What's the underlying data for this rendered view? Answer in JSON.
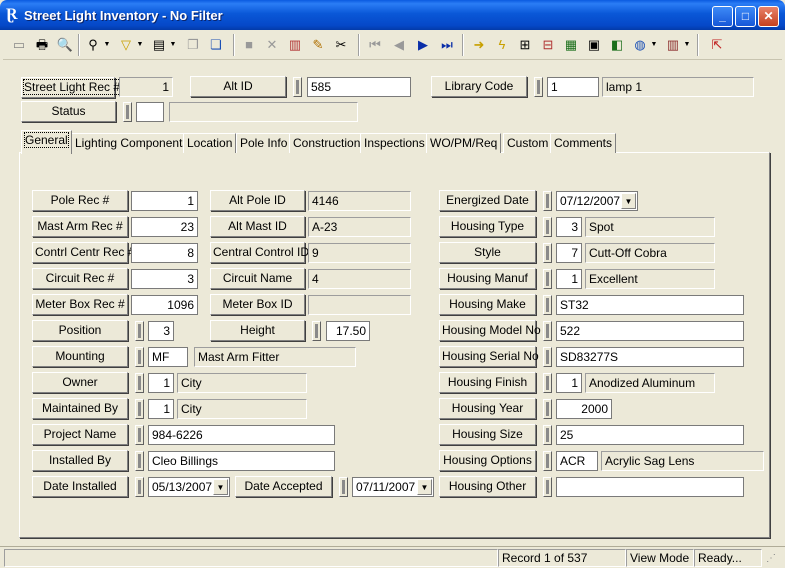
{
  "window": {
    "title": "Street Light Inventory - No Filter",
    "app_icon_glyph": "Ɽ"
  },
  "toolbar": {
    "icons": [
      "new-record-icon",
      "print-icon",
      "print-preview-icon",
      "binoculars-icon",
      "filter-icon",
      "form-icon",
      "copy-record-icon",
      "window-icon",
      "save-icon",
      "delete-icon",
      "books-icon",
      "pencil-icon",
      "scissors-icon",
      "first-record-icon",
      "previous-record-icon",
      "next-record-icon",
      "last-record-icon",
      "goto-icon",
      "lightning-icon",
      "tree-icon",
      "hierarchy-icon",
      "map-icon",
      "calculator-icon",
      "gis-icon",
      "globe-icon",
      "library-icon",
      "exit-icon"
    ]
  },
  "header": {
    "rec_label": "Street Light Rec #",
    "rec_value": "1",
    "alt_id_label": "Alt ID",
    "alt_id_value": "585",
    "library_code_label": "Library Code",
    "library_code_value": "1",
    "library_code_desc": "lamp 1",
    "status_label": "Status",
    "status_value": "",
    "status_desc": ""
  },
  "tabs": [
    "General",
    "Lighting Components",
    "Location",
    "Pole Info",
    "Construction",
    "Inspections",
    "WO/PM/Req",
    "Custom",
    "Comments"
  ],
  "general": {
    "pole_rec_label": "Pole Rec #",
    "pole_rec_value": "1",
    "alt_pole_id_label": "Alt Pole ID",
    "alt_pole_id_value": "4146",
    "mast_arm_rec_label": "Mast Arm Rec #",
    "mast_arm_rec_value": "23",
    "alt_mast_id_label": "Alt Mast ID",
    "alt_mast_id_value": "A-23",
    "contrl_centr_rec_label": "Contrl Centr Rec #",
    "contrl_centr_rec_value": "8",
    "central_control_id_label": "Central Control ID",
    "central_control_id_value": "9",
    "circuit_rec_label": "Circuit Rec #",
    "circuit_rec_value": "3",
    "circuit_name_label": "Circuit Name",
    "circuit_name_value": "4",
    "meter_box_rec_label": "Meter Box Rec #",
    "meter_box_rec_value": "1096",
    "meter_box_id_label": "Meter Box ID",
    "meter_box_id_value": "",
    "position_label": "Position",
    "position_value": "3",
    "height_label": "Height",
    "height_value": "17.50",
    "mounting_label": "Mounting",
    "mounting_code": "MF",
    "mounting_desc": "Mast Arm Fitter",
    "owner_label": "Owner",
    "owner_code": "1",
    "owner_desc": "City",
    "maintained_by_label": "Maintained By",
    "maintained_by_code": "1",
    "maintained_by_desc": "City",
    "project_name_label": "Project Name",
    "project_name_value": "984-6226",
    "installed_by_label": "Installed By",
    "installed_by_value": "Cleo Billings",
    "date_installed_label": "Date Installed",
    "date_installed_value": "05/13/2007",
    "date_accepted_label": "Date Accepted",
    "date_accepted_value": "07/11/2007",
    "energized_date_label": "Energized Date",
    "energized_date_value": "07/12/2007",
    "housing_type_label": "Housing Type",
    "housing_type_code": "3",
    "housing_type_desc": "Spot",
    "style_label": "Style",
    "style_code": "7",
    "style_desc": "Cutt-Off Cobra",
    "housing_manuf_label": "Housing Manuf",
    "housing_manuf_code": "1",
    "housing_manuf_desc": "Excellent",
    "housing_make_label": "Housing Make",
    "housing_make_value": "ST32",
    "housing_model_label": "Housing Model No",
    "housing_model_value": "522",
    "housing_serial_label": "Housing Serial No",
    "housing_serial_value": "SD83277S",
    "housing_finish_label": "Housing Finish",
    "housing_finish_code": "1",
    "housing_finish_desc": "Anodized Aluminum",
    "housing_year_label": "Housing Year",
    "housing_year_value": "2000",
    "housing_size_label": "Housing Size",
    "housing_size_value": "25",
    "housing_options_label": "Housing Options",
    "housing_options_code": "ACR",
    "housing_options_desc": "Acrylic Sag Lens",
    "housing_other_label": "Housing Other",
    "housing_other_value": ""
  },
  "statusbar": {
    "record": "Record 1 of 537",
    "mode": "View Mode",
    "state": "Ready..."
  }
}
